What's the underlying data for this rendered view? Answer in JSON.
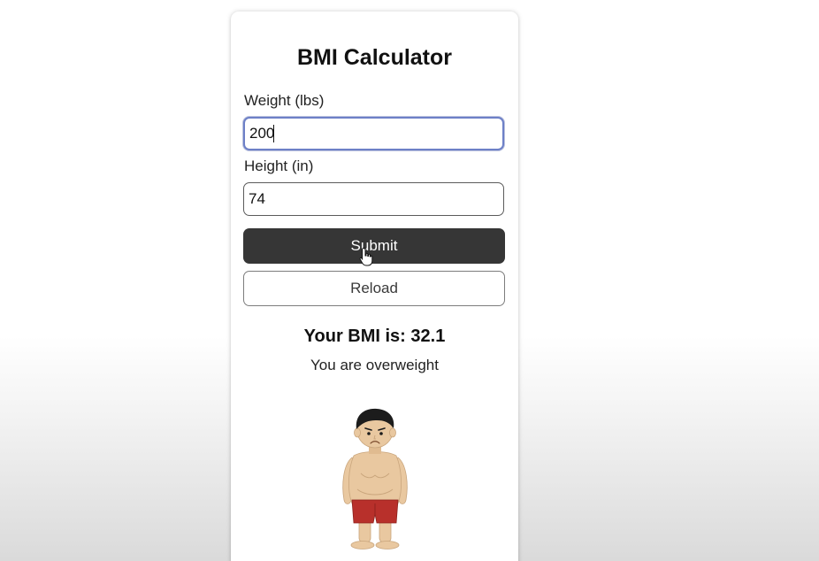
{
  "app": {
    "title": "BMI Calculator"
  },
  "form": {
    "weight": {
      "label": "Weight (lbs)",
      "value": "200"
    },
    "height": {
      "label": "Height (in)",
      "value": "74"
    },
    "submit_label": "Submit",
    "reload_label": "Reload"
  },
  "result": {
    "bmi_text": "Your BMI is: 32.1",
    "status_text": "You are overweight",
    "image_icon": "overweight-person-illustration"
  },
  "colors": {
    "submit_bg": "#363636",
    "focus_border": "#6d80c7",
    "shorts": "#b8302b",
    "skin": "#e9c8a0"
  }
}
